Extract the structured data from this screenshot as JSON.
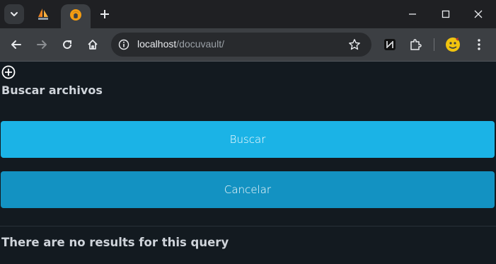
{
  "browser": {
    "address_bar": {
      "host": "localhost",
      "path": "/docuvault/"
    },
    "icons": {
      "tab_search": "chevron-down-icon",
      "new_tab": "plus-icon",
      "back": "arrow-left-icon",
      "forward": "arrow-right-icon",
      "reload": "reload-icon",
      "home": "home-icon",
      "site_info": "info-icon",
      "bookmark": "star-icon",
      "extensions": "puzzle-icon",
      "menu": "kebab-menu-icon"
    }
  },
  "page": {
    "add_icon": "plus-circle-icon",
    "title": "Buscar archivos",
    "search_button_label": "Buscar",
    "cancel_button_label": "Cancelar",
    "no_results_text": "There are no results for this query"
  },
  "colors": {
    "page_background": "#131a20",
    "search_button": "#1bb3e6",
    "cancel_button": "#1392c2",
    "text": "#cfd4da"
  }
}
